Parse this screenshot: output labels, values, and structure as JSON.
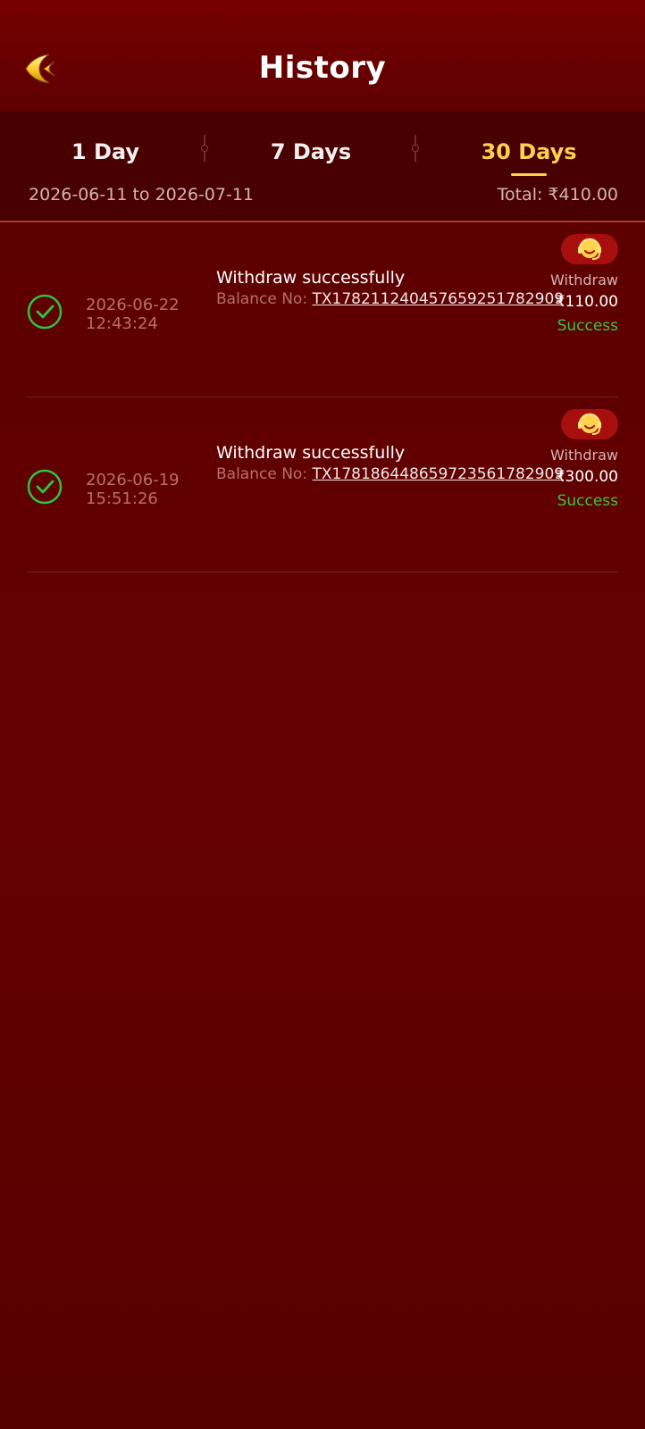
{
  "header": {
    "title": "History",
    "back_icon": "back-arrow-icon"
  },
  "filters": {
    "tabs": [
      {
        "label": "1 Day",
        "active": false
      },
      {
        "label": "7 Days",
        "active": false
      },
      {
        "label": "30 Days",
        "active": true
      }
    ],
    "date_range": "2026-06-11 to 2026-07-11",
    "total": "Total: ₹410.00"
  },
  "transactions": [
    {
      "date": "2026-06-22",
      "time": "12:43:24",
      "title": "Withdraw successfully",
      "balance_label": "Balance No:",
      "tx_id": "TX1782112404576592517829​09",
      "type": "Withdraw",
      "amount": "₹110.00",
      "status": "Success"
    },
    {
      "date": "2026-06-19",
      "time": "15:51:26",
      "title": "Withdraw successfully",
      "balance_label": "Balance No:",
      "tx_id": "TX17818644865972356178290​9",
      "type": "Withdraw",
      "amount": "₹300.00",
      "status": "Success"
    }
  ],
  "colors": {
    "accent": "#ffd24d",
    "success": "#3cc43c",
    "background": "#5e0000"
  }
}
